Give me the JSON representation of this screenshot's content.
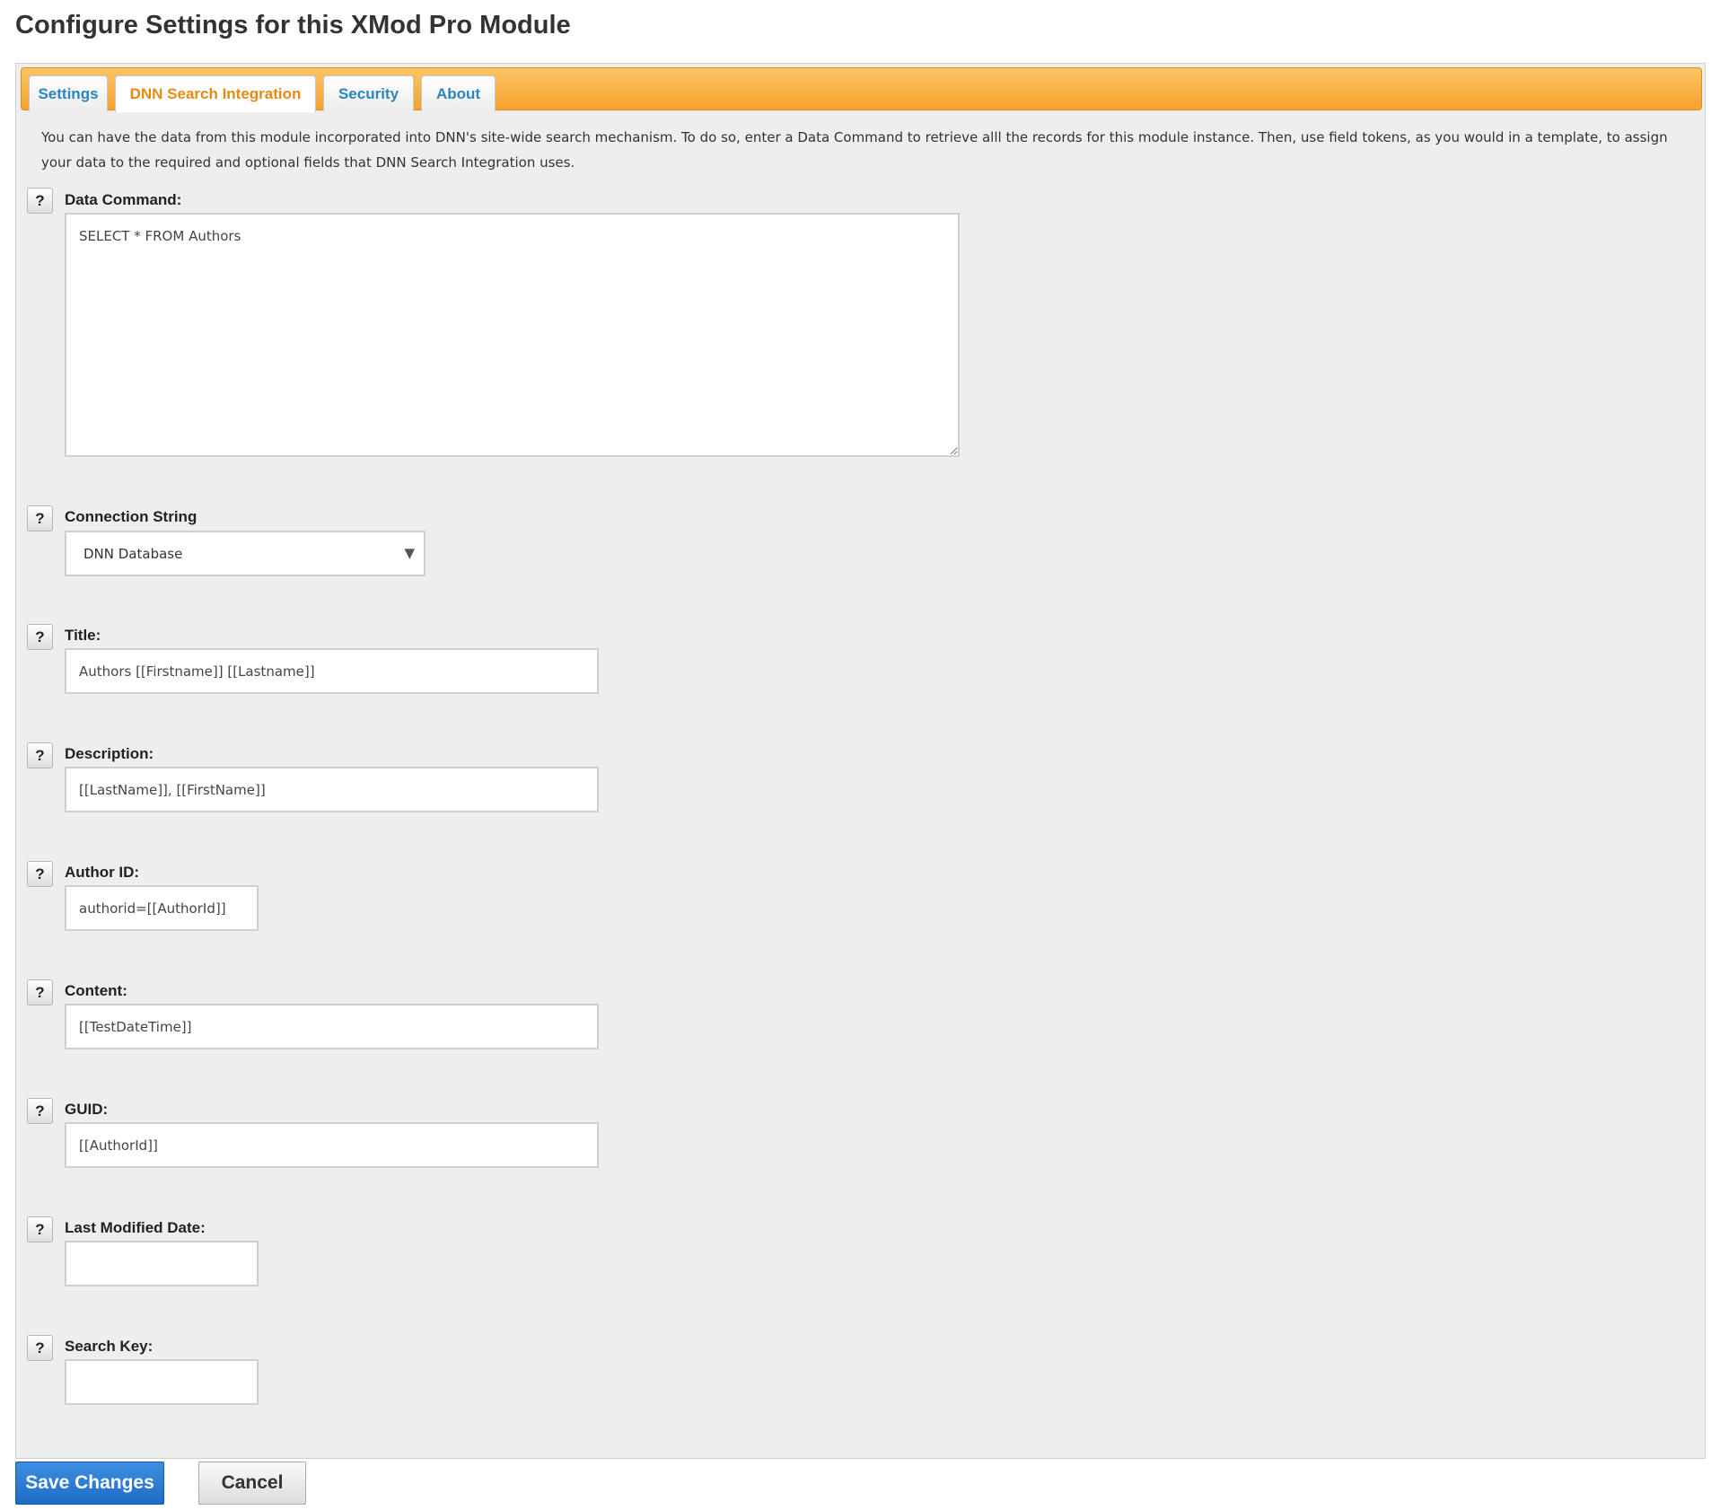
{
  "page": {
    "title": "Configure Settings for this XMod Pro Module"
  },
  "tabs": [
    {
      "label": "Settings",
      "active": false
    },
    {
      "label": "DNN Search Integration",
      "active": true
    },
    {
      "label": "Security",
      "active": false
    },
    {
      "label": "About",
      "active": false
    }
  ],
  "intro_text": "You can have the data from this module incorporated into DNN's site-wide search mechanism. To do so, enter a Data Command to retrieve alll the records for this module instance. Then, use field tokens, as you would in a template, to assign your data to the required and optional fields that DNN Search Integration uses.",
  "help_glyph": "?",
  "fields": {
    "data_command": {
      "label": "Data Command:",
      "value": "SELECT * FROM Authors"
    },
    "connection_string": {
      "label": "Connection String",
      "selected": "DNN Database",
      "chevron": "▼"
    },
    "title": {
      "label": "Title:",
      "value": "Authors [[Firstname]] [[Lastname]]"
    },
    "description": {
      "label": "Description:",
      "value": "[[LastName]], [[FirstName]]"
    },
    "author_id": {
      "label": "Author ID:",
      "value": "authorid=[[AuthorId]]"
    },
    "content": {
      "label": "Content:",
      "value": "[[TestDateTime]]"
    },
    "guid": {
      "label": "GUID:",
      "value": "[[AuthorId]]"
    },
    "last_modified_date": {
      "label": "Last Modified Date:",
      "value": ""
    },
    "search_key": {
      "label": "Search Key:",
      "value": ""
    }
  },
  "buttons": {
    "save": "Save Changes",
    "cancel": "Cancel"
  },
  "colors": {
    "tab_bar": "#f3a22f",
    "tab_text": "#2a86bd",
    "tab_active_text": "#e58b12",
    "save_button": "#1f6cc7",
    "panel_bg": "#eeeeee"
  }
}
